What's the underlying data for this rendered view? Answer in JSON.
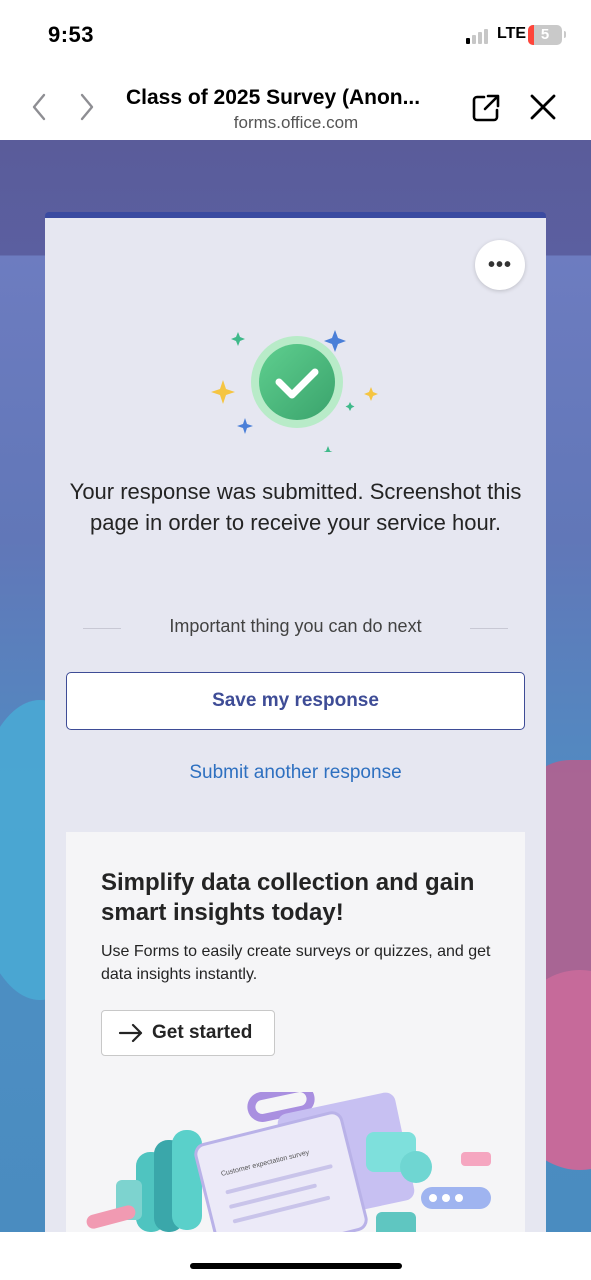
{
  "status_bar": {
    "time": "9:53",
    "network": "LTE",
    "battery_level": "5",
    "battery_color": "#ff453a"
  },
  "browser": {
    "back_icon": "chevron-left-icon",
    "forward_icon": "chevron-right-icon",
    "title": "Class of 2025 Survey (Anon...",
    "url": "forms.office.com",
    "share_icon": "open-external-icon",
    "close_icon": "close-icon"
  },
  "card": {
    "more_label": "•••",
    "confirmation": "Your response was submitted. Screenshot this page in order to receive your service hour.",
    "next_heading": "Important thing you can do next",
    "save_button": "Save my response",
    "submit_another": "Submit another response",
    "accent_color": "#3e4c96",
    "link_color": "#2e70c0"
  },
  "promo": {
    "title": "Simplify data collection and gain smart insights today!",
    "description": "Use Forms to easily create surveys or quizzes, and get data insights instantly.",
    "cta": "Get started",
    "illustration_caption": "Customer expectation survey"
  }
}
